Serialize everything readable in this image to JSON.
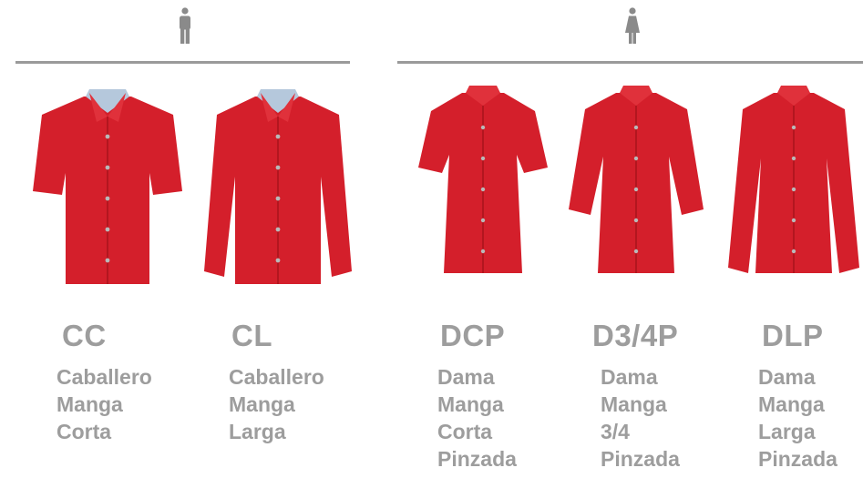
{
  "sections": [
    {
      "icon": "male-person-icon",
      "color": "#8a8a8a"
    },
    {
      "icon": "female-person-icon",
      "color": "#8a8a8a"
    }
  ],
  "accent": "#d41f2b",
  "products": [
    {
      "code": "CC",
      "lines": [
        "Caballero",
        "Manga",
        "Corta"
      ]
    },
    {
      "code": "CL",
      "lines": [
        "Caballero",
        "Manga",
        "Larga"
      ]
    },
    {
      "code": "DCP",
      "lines": [
        "Dama",
        "Manga",
        "Corta",
        "Pinzada"
      ]
    },
    {
      "code": "D3/4P",
      "lines": [
        "Dama",
        "Manga",
        "3/4",
        "Pinzada"
      ]
    },
    {
      "code": "DLP",
      "lines": [
        "Dama",
        "Manga",
        "Larga",
        "Pinzada"
      ]
    }
  ]
}
